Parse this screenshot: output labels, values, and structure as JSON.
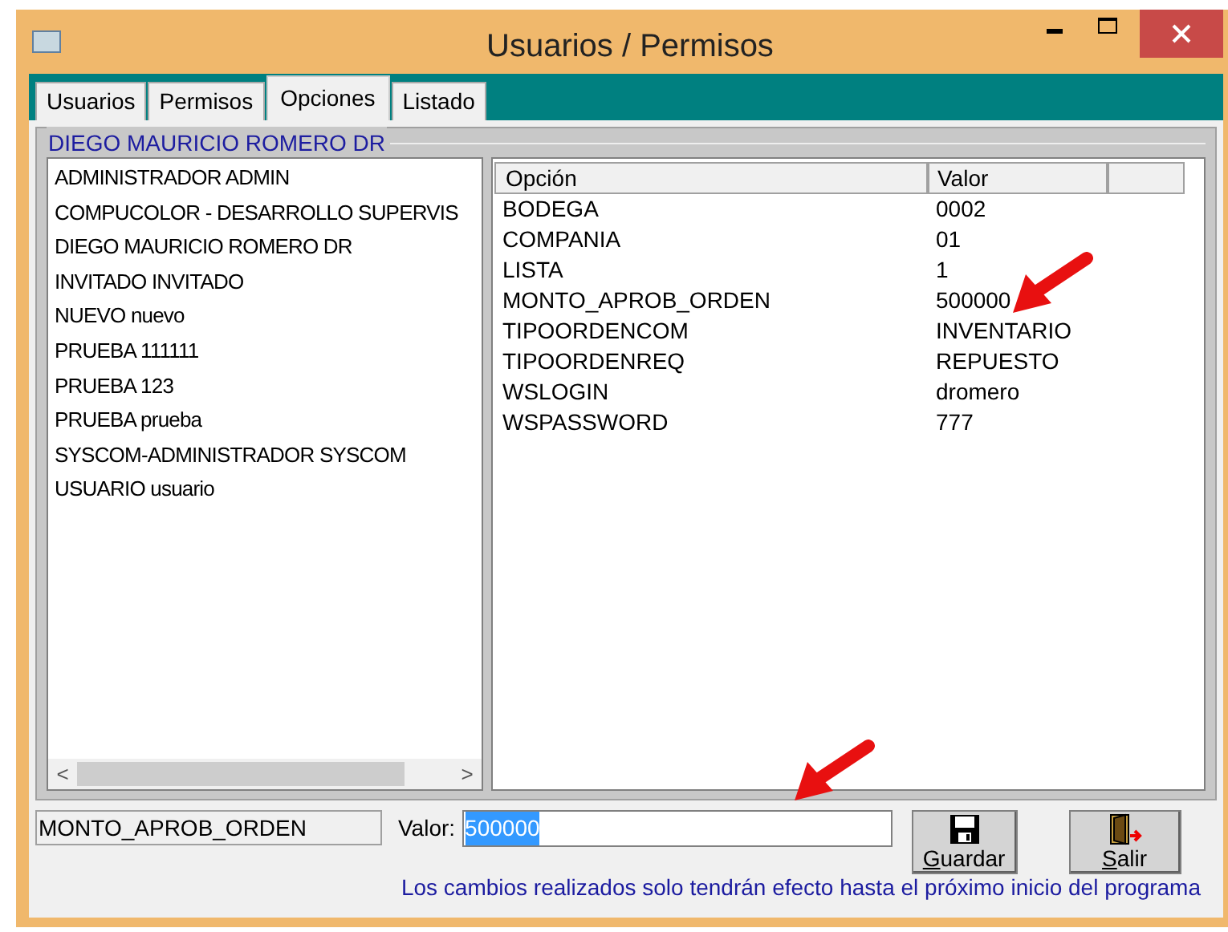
{
  "window": {
    "title": "Usuarios / Permisos"
  },
  "tabs": [
    {
      "label": "Usuarios",
      "selected": false
    },
    {
      "label": "Permisos",
      "selected": false
    },
    {
      "label": "Opciones",
      "selected": true
    },
    {
      "label": "Listado",
      "selected": false
    }
  ],
  "group": {
    "title": "DIEGO MAURICIO ROMERO DR"
  },
  "users": [
    {
      "label": "ADMINISTRADOR ADMIN",
      "selected": false
    },
    {
      "label": "COMPUCOLOR - DESARROLLO SUPERVIS",
      "selected": false
    },
    {
      "label": "DIEGO MAURICIO ROMERO DR",
      "selected": false
    },
    {
      "label": "INVITADO INVITADO",
      "selected": false
    },
    {
      "label": "NUEVO nuevo",
      "selected": false
    },
    {
      "label": "PRUEBA 111111",
      "selected": false
    },
    {
      "label": "PRUEBA 123",
      "selected": false
    },
    {
      "label": "PRUEBA prueba",
      "selected": false
    },
    {
      "label": "SYSCOM-ADMINISTRADOR SYSCOM",
      "selected": false
    },
    {
      "label": "USUARIO usuario",
      "selected": false
    }
  ],
  "scroll_buttons": {
    "left": "<",
    "right": ">"
  },
  "table": {
    "columns": [
      "Opción",
      "Valor"
    ],
    "rows": [
      [
        "BODEGA",
        "0002"
      ],
      [
        "COMPANIA",
        "01"
      ],
      [
        "LISTA",
        "1"
      ],
      [
        "MONTO_APROB_ORDEN",
        "500000"
      ],
      [
        "TIPOORDENCOM",
        "INVENTARIO"
      ],
      [
        "TIPOORDENREQ",
        "REPUESTO"
      ],
      [
        "WSLOGIN",
        "dromero"
      ],
      [
        "WSPASSWORD",
        "777"
      ]
    ]
  },
  "option_field": {
    "value": "MONTO_APROB_ORDEN"
  },
  "value_field": {
    "label": "Valor:",
    "value": "500000",
    "text_selected": true
  },
  "buttons": [
    {
      "kind": "save",
      "label": "Guardar"
    },
    {
      "kind": "exit",
      "label": "Salir"
    }
  ],
  "note": "Los cambios realizados solo tendrán efecto hasta el próximo inicio del programa"
}
